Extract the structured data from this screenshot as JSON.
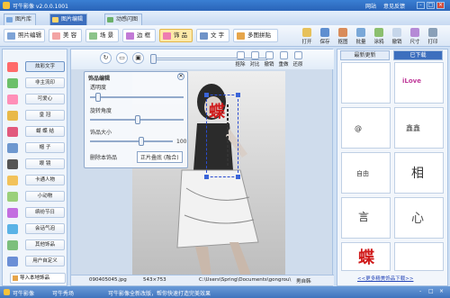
{
  "titlebar": {
    "title": "可牛影像 v2.0.0.1001",
    "links": [
      "网站",
      "意见反馈"
    ]
  },
  "tabs": [
    {
      "label": "图片库"
    },
    {
      "label": "图片编辑"
    },
    {
      "label": "动感闪图"
    }
  ],
  "toolbar": {
    "tools": [
      "照片编辑",
      "美 容",
      "场 景",
      "边 框",
      "饰 品",
      "文 字",
      "多图拼贴"
    ],
    "right_tools": [
      "打开",
      "保存",
      "抠图",
      "批量",
      "涂鸦",
      "撤销",
      "尺寸",
      "打印"
    ]
  },
  "left_panel": {
    "items": [
      "炫彩文字",
      "非主流印",
      "可爱心",
      "皇 冠",
      "蝴 蝶 结",
      "帽 子",
      "眼 镜",
      "卡通人物",
      "小动物",
      "缤纷节日",
      "会话气泡",
      "其他饰品",
      "用户自定义"
    ],
    "import_button": "导入本地饰品"
  },
  "canvas": {
    "tools": [
      "抠除",
      "对比",
      "撤销",
      "重做",
      "还原"
    ],
    "panel": {
      "title": "饰品编辑",
      "opacity_label": "透明度",
      "rotate_label": "旋转角度",
      "size_label": "饰品大小",
      "size_value": "100",
      "delete_label": "删除本饰品",
      "apply_label": "正片叠底 (融合)"
    },
    "status": {
      "filename": "090405045.jpg",
      "dimensions": "543×753",
      "path": "C:\\Users\\Spring\\Documents\\gongrou\\",
      "extra": "男自韩"
    },
    "sticker_text": "蝶"
  },
  "right_panel": {
    "tabs": [
      "最新更新",
      "已下载"
    ],
    "thumbs": [
      "iLove",
      "@",
      "鑫鑫",
      "自由",
      "相",
      "言",
      "蝶",
      "心"
    ],
    "download_link": "<<更多精美饰品下载>>"
  },
  "bottombar": {
    "left_label": "可牛影像",
    "mid_label": "可牛秀场",
    "status_text": "可牛影像全新改版，帮你快速打造完美效果",
    "right_icons": [
      "-",
      "□",
      "×"
    ]
  }
}
